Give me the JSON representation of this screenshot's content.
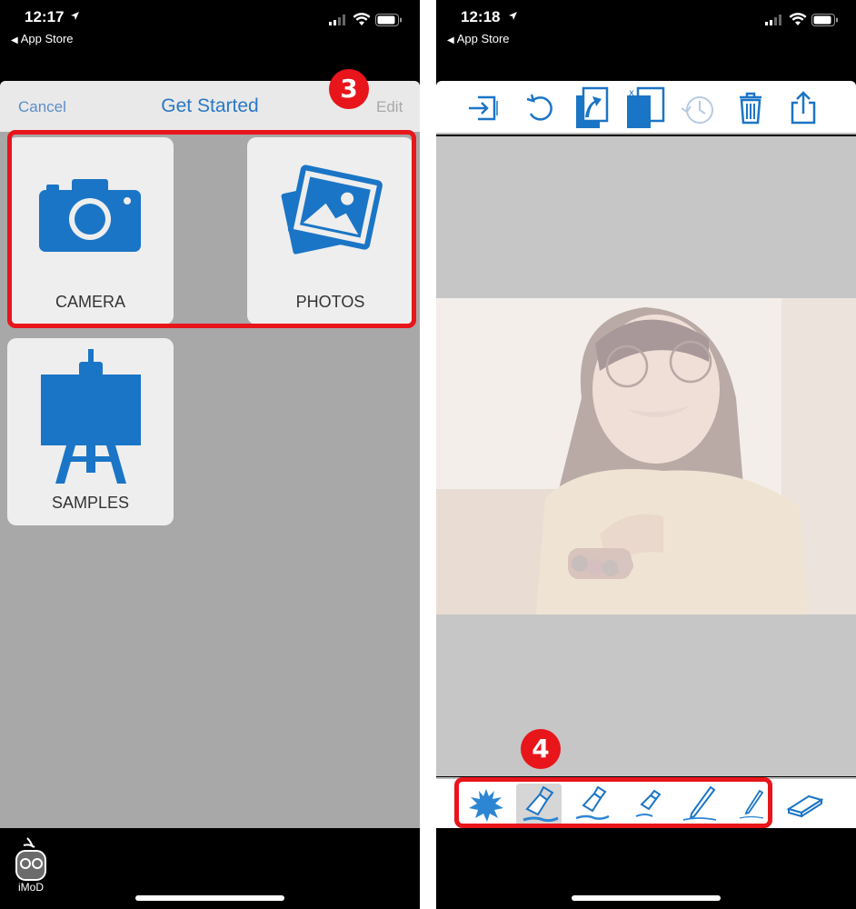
{
  "left_screen": {
    "status": {
      "time": "12:17",
      "back_label": "App Store"
    },
    "nav": {
      "cancel": "Cancel",
      "title": "Get Started",
      "edit": "Edit"
    },
    "tiles": [
      {
        "label": "CAMERA",
        "icon": "camera-icon"
      },
      {
        "label": "PHOTOS",
        "icon": "photos-icon"
      },
      {
        "label": "SAMPLES",
        "icon": "easel-icon"
      }
    ],
    "step_badge": "3",
    "watermark": "iMoD"
  },
  "right_screen": {
    "status": {
      "time": "12:18",
      "back_label": "App Store"
    },
    "toolbar_icons": [
      "import-icon",
      "undo-icon",
      "layer-up-icon",
      "clear-layer-icon",
      "history-icon",
      "trash-icon",
      "share-icon"
    ],
    "brush_tools": [
      "splatter-brush-icon",
      "wide-brush-icon",
      "medium-brush-icon",
      "small-brush-icon",
      "fine-pen-icon",
      "thin-pen-icon",
      "eraser-icon"
    ],
    "selected_tool": "wide-brush-icon",
    "step_badge": "4"
  },
  "colors": {
    "accent": "#1b75c6",
    "highlight": "#e8151b",
    "nav_title": "#2a78c4"
  }
}
